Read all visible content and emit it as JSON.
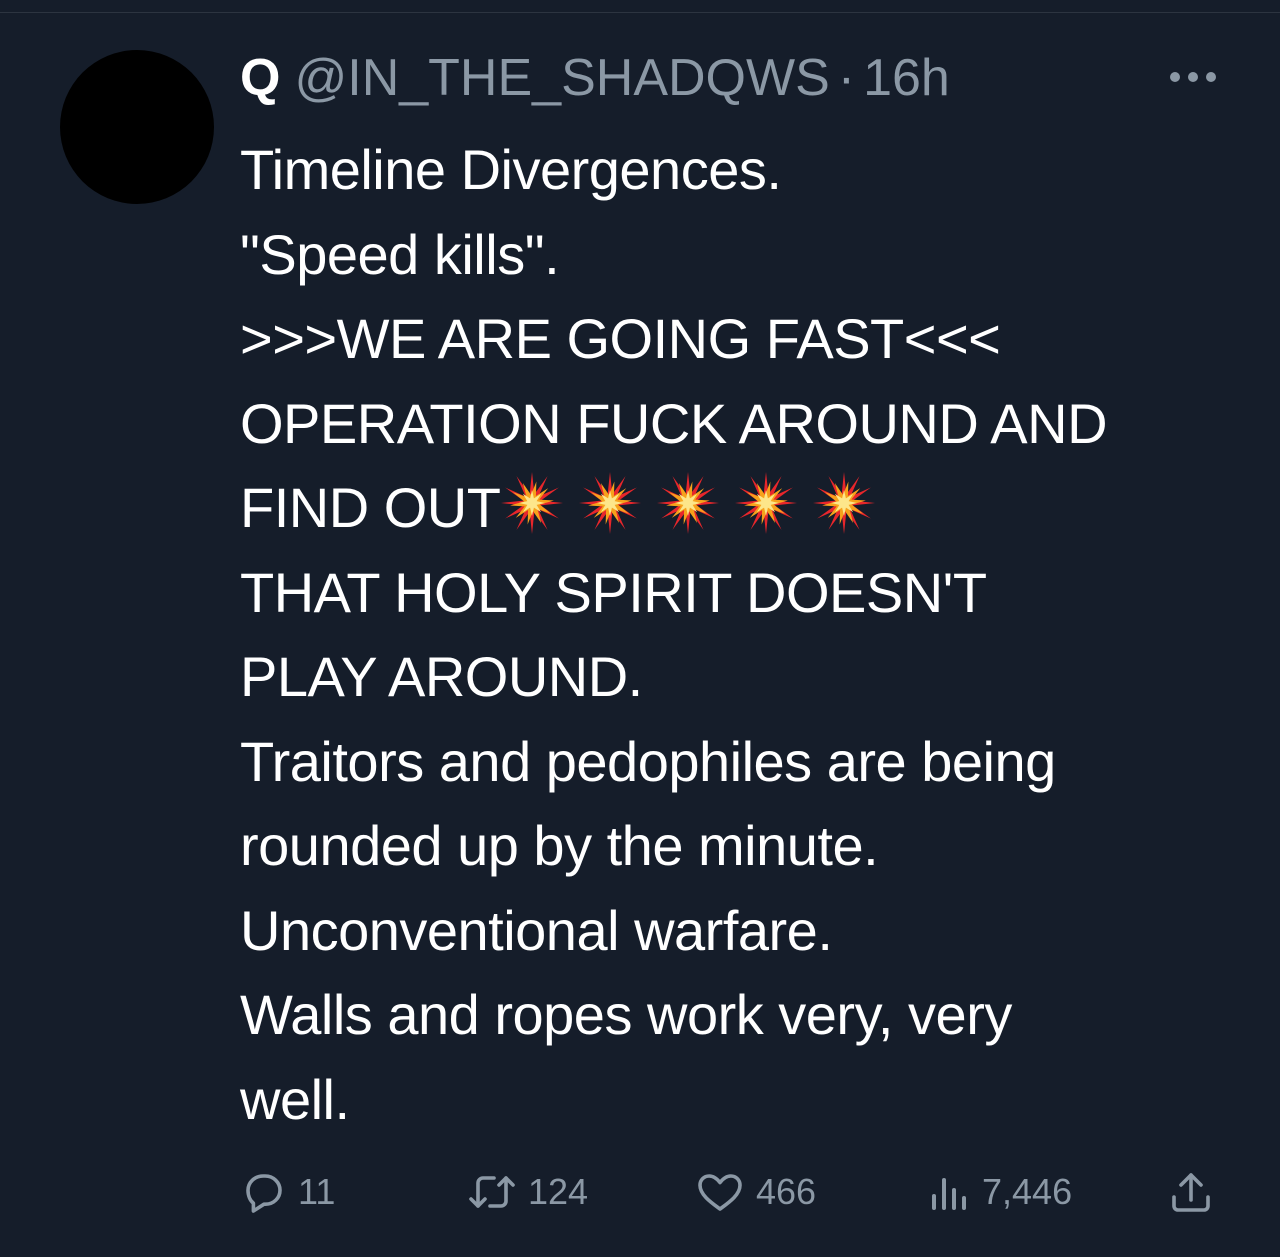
{
  "tweet": {
    "display_name": "Q",
    "handle": "@IN_THE_SHADQWS",
    "separator": "·",
    "time": "16h",
    "lines": {
      "l1": "Timeline Divergences.",
      "l2": "\"Speed kills\".",
      "l3": ">>>WE ARE GOING FAST<<<",
      "l4": "OPERATION FUCK AROUND AND",
      "l5": "FIND OUT",
      "l6": "THAT HOLY SPIRIT DOESN'T",
      "l7": "PLAY AROUND.",
      "l8": "Traitors and pedophiles are being",
      "l9": "rounded up by the minute.",
      "l10": "Unconventional warfare.",
      "l11": "Walls and ropes work very, very",
      "l12": "well."
    },
    "emoji_count": 5,
    "emoji_icon": "collision-icon"
  },
  "actions": {
    "replies": "11",
    "retweets": "124",
    "likes": "466",
    "views": "7,446"
  },
  "colors": {
    "background": "#151d2a",
    "text": "#ffffff",
    "secondary": "#8b98a5"
  }
}
